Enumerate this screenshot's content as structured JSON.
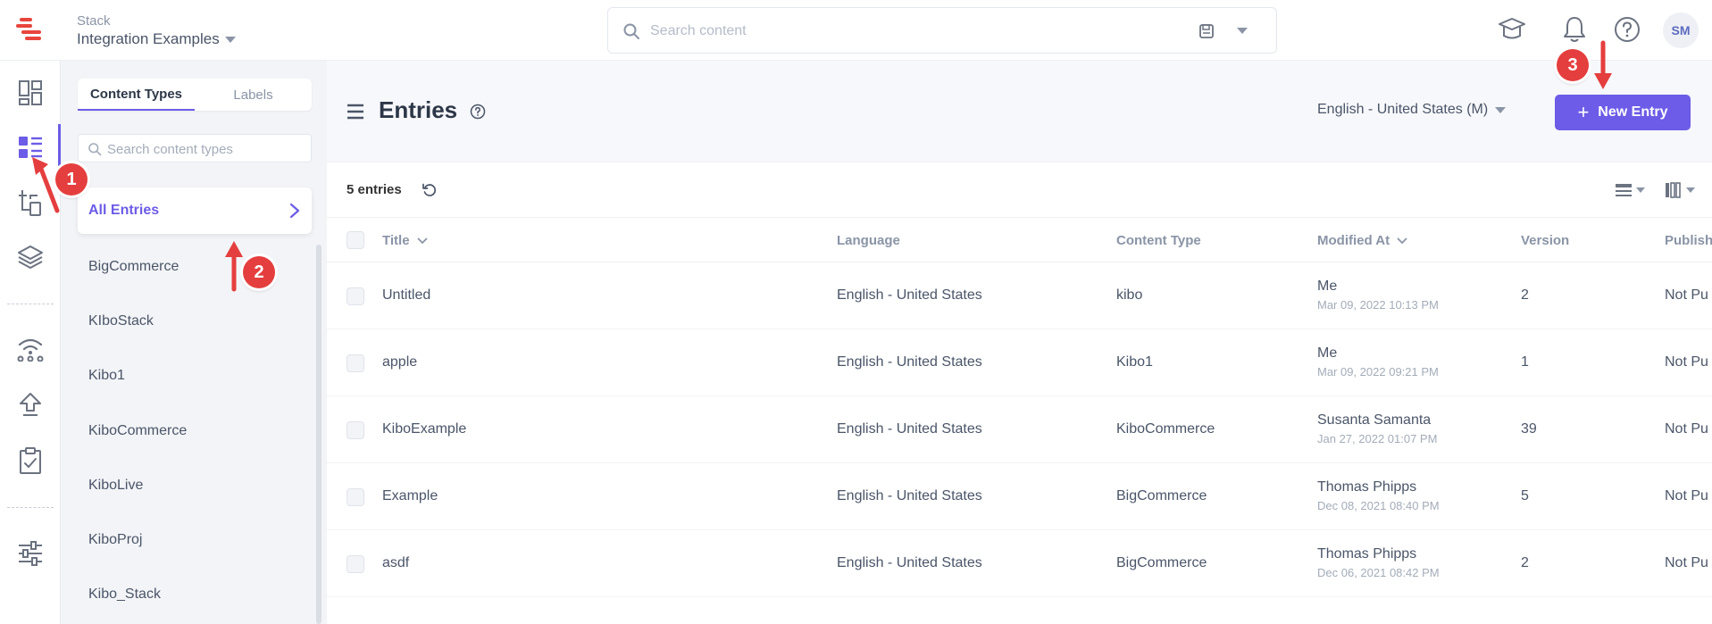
{
  "header": {
    "stack_label": "Stack",
    "stack_name": "Integration Examples",
    "search_placeholder": "Search content",
    "avatar_initials": "SM"
  },
  "sidebar": {
    "tabs": [
      {
        "label": "Content Types",
        "active": true
      },
      {
        "label": "Labels",
        "active": false
      }
    ],
    "search_placeholder": "Search content types",
    "all_entries_label": "All Entries",
    "content_types": [
      "BigCommerce",
      "KIboStack",
      "Kibo1",
      "KiboCommerce",
      "KiboLive",
      "KiboProj",
      "Kibo_Stack"
    ]
  },
  "main": {
    "title": "Entries",
    "language": "English - United States (M)",
    "new_entry_label": "New Entry",
    "entry_count": "5 entries"
  },
  "table": {
    "columns": [
      "Title",
      "Language",
      "Content Type",
      "Modified At",
      "Version",
      "Publish"
    ],
    "rows": [
      {
        "title": "Untitled",
        "language": "English - United States",
        "content_type": "kibo",
        "modified_by": "Me",
        "modified_at": "Mar 09, 2022 10:13 PM",
        "version": "2",
        "publish": "Not Pu"
      },
      {
        "title": "apple",
        "language": "English - United States",
        "content_type": "Kibo1",
        "modified_by": "Me",
        "modified_at": "Mar 09, 2022 09:21 PM",
        "version": "1",
        "publish": "Not Pu"
      },
      {
        "title": "KiboExample",
        "language": "English - United States",
        "content_type": "KiboCommerce",
        "modified_by": "Susanta Samanta",
        "modified_at": "Jan 27, 2022 01:07 PM",
        "version": "39",
        "publish": "Not Pu"
      },
      {
        "title": "Example",
        "language": "English - United States",
        "content_type": "BigCommerce",
        "modified_by": "Thomas Phipps",
        "modified_at": "Dec 08, 2021 08:40 PM",
        "version": "5",
        "publish": "Not Pu"
      },
      {
        "title": "asdf",
        "language": "English - United States",
        "content_type": "BigCommerce",
        "modified_by": "Thomas Phipps",
        "modified_at": "Dec 06, 2021 08:42 PM",
        "version": "2",
        "publish": "Not Pu"
      }
    ]
  },
  "annotations": [
    "1",
    "2",
    "3"
  ],
  "colors": {
    "accent": "#6c5ce7",
    "logo": "#e8453c",
    "annotation": "#e53e3e"
  },
  "icons": {
    "rail": [
      "dashboard-icon",
      "content-models-icon",
      "entries-tree-icon",
      "assets-layers-icon",
      "webhooks-icon",
      "deploy-icon",
      "releases-icon",
      "settings-sliders-icon"
    ],
    "top": [
      "academy-icon",
      "notifications-bell-icon",
      "help-icon"
    ]
  }
}
